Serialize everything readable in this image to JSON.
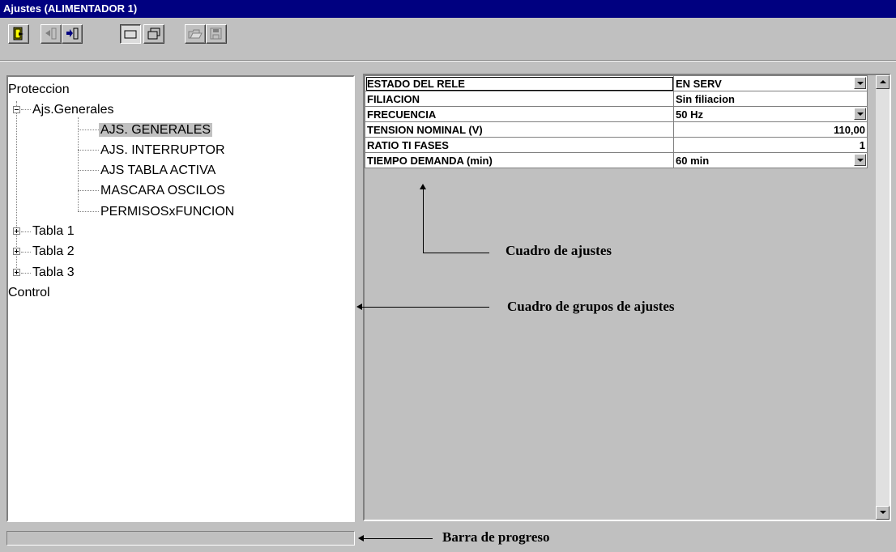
{
  "window": {
    "title": "Ajustes (ALIMENTADOR 1)"
  },
  "toolbar": {
    "buttons": [
      {
        "name": "exit-button",
        "icon": "door-exit-icon",
        "enabled": true
      },
      {
        "name": "previous-button",
        "icon": "arrow-back-icon",
        "enabled": false
      },
      {
        "name": "next-button",
        "icon": "arrow-forward-icon",
        "enabled": true
      },
      {
        "name": "single-view-button",
        "icon": "single-window-icon",
        "enabled": true,
        "pressed": true
      },
      {
        "name": "multi-view-button",
        "icon": "multi-window-icon",
        "enabled": true
      },
      {
        "name": "open-button",
        "icon": "open-folder-icon",
        "enabled": false
      },
      {
        "name": "save-button",
        "icon": "floppy-disk-icon",
        "enabled": false
      }
    ]
  },
  "tree": {
    "proteccion": "Proteccion",
    "ajs_generales": "Ajs.Generales",
    "children": [
      "AJS. GENERALES",
      "AJS. INTERRUPTOR",
      "AJS TABLA ACTIVA",
      "MASCARA OSCILOS",
      "PERMISOSxFUNCION"
    ],
    "selected": "AJS. GENERALES",
    "tablas": [
      "Tabla 1",
      "Tabla 2",
      "Tabla 3"
    ],
    "control": "Control"
  },
  "settings": {
    "rows": [
      {
        "name": "ESTADO DEL RELE",
        "value": "EN SERV",
        "dropdown": true
      },
      {
        "name": "FILIACION",
        "value": "Sin filiacion",
        "dropdown": false
      },
      {
        "name": "FRECUENCIA",
        "value": "50 Hz",
        "dropdown": true
      },
      {
        "name": "TENSION NOMINAL (V)",
        "value": "110,00",
        "dropdown": false,
        "numeric": true
      },
      {
        "name": "RATIO TI FASES",
        "value": "1",
        "dropdown": false,
        "numeric": true
      },
      {
        "name": "TIEMPO DEMANDA (min)",
        "value": "60 min",
        "dropdown": true
      }
    ]
  },
  "annotations": {
    "cuadro_ajustes": "Cuadro de ajustes",
    "cuadro_grupos": "Cuadro de grupos de ajustes",
    "barra_progreso": "Barra de progreso"
  },
  "colors": {
    "titlebar": "#000080",
    "face": "#c0c0c0",
    "selection": "#c0c0c0"
  }
}
